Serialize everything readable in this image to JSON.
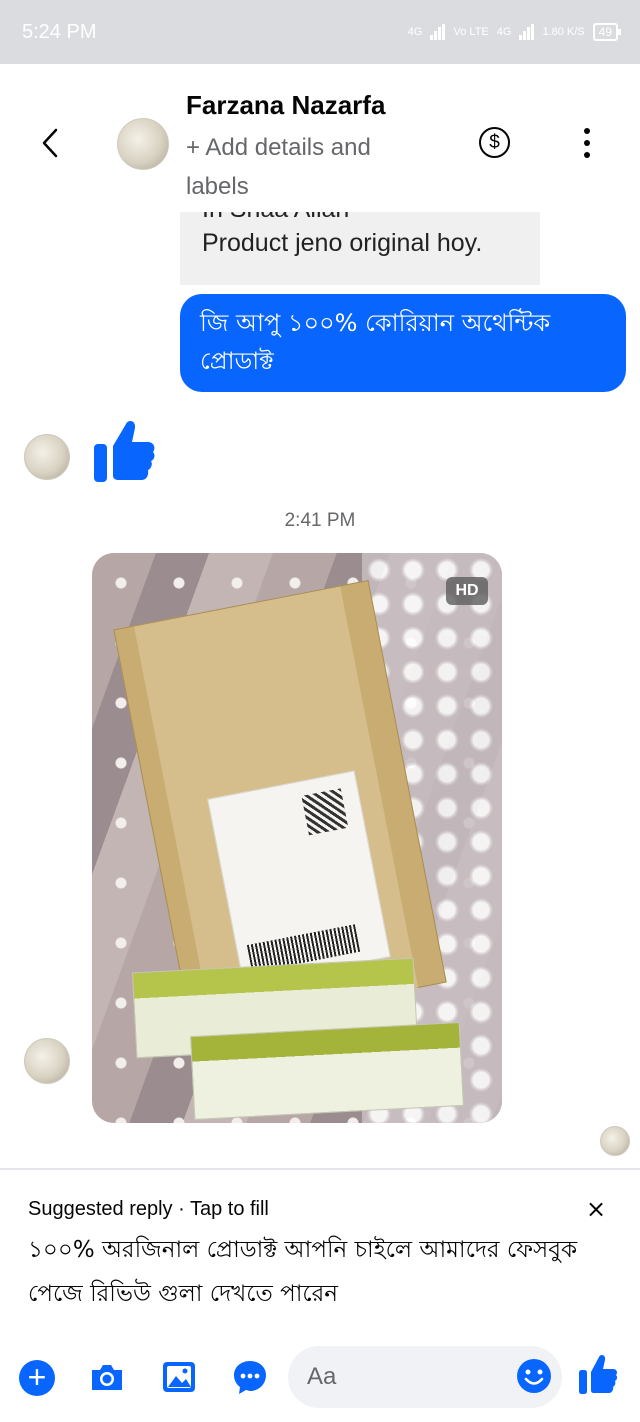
{
  "status_bar": {
    "time": "5:24 PM",
    "network_1": "4G",
    "volte": "Vo LTE",
    "network_2": "4G",
    "speed": "1.80 K/S",
    "battery": "49"
  },
  "header": {
    "contact_name": "Farzana Nazarfa",
    "subtitle": "+ Add details and labels",
    "icons": [
      "back-chevron-icon",
      "dollar-icon",
      "more-vertical-icon"
    ]
  },
  "messages": {
    "incoming_line1": "In Shaa Allah",
    "incoming_line2": "Product jeno original hoy.",
    "outgoing": "জি আপু ১০০% কোরিয়ান অথেন্টিক প্রোডাক্ট",
    "timestamp": "2:41 PM",
    "hd_badge": "HD"
  },
  "suggested_reply": {
    "header": "Suggested reply · Tap to fill",
    "close": "×",
    "text": "১০০% অরজিনাল প্রোডাক্ট আপনি চাইলে আমাদের ফেসবুক পেজে রিভিউ গুলা দেখতে পারেন"
  },
  "composer": {
    "placeholder": "Aa",
    "plus": "+"
  },
  "colors": {
    "accent": "#0866ff",
    "status_bar": "#dadce0",
    "incoming_bubble": "#f0f0f0",
    "input_bg": "#f0f2f5",
    "muted_text": "#65676b"
  }
}
